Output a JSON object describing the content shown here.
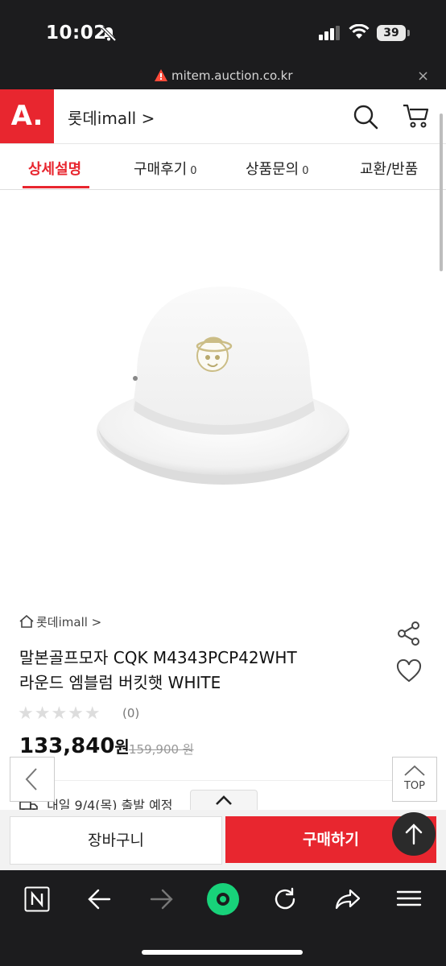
{
  "status": {
    "time": "10:02",
    "battery": "39"
  },
  "browser": {
    "url": "mitem.auction.co.kr",
    "close": "×"
  },
  "header": {
    "logo": "A.",
    "store_link": "롯데imall >"
  },
  "tabs": [
    {
      "label": "상세설명",
      "count": ""
    },
    {
      "label": "구매후기",
      "count": "0"
    },
    {
      "label": "상품문의",
      "count": "0"
    },
    {
      "label": "교환/반품",
      "count": ""
    }
  ],
  "product": {
    "store": "롯데imall >",
    "title_line1": "말본골프모자 CQK M4343PCP42WHT",
    "title_line2": "라운드 엠블럼 버킷햇 WHITE",
    "stars": "★★★★★",
    "rating": 0,
    "review_count": "(0)",
    "price": "133,840",
    "price_unit": "원",
    "original_price": "159,900 원",
    "shipping": "내일 9/4(목) 출발 예정"
  },
  "floating": {
    "top_label": "TOP"
  },
  "bottom": {
    "cart_label": "장바구니",
    "buy_label": "구매하기"
  },
  "colors": {
    "brand": "#e8262f",
    "browser_accent": "#18d27a"
  },
  "icons": [
    "bell-slash-icon",
    "signal-icon",
    "wifi-icon",
    "warning-icon",
    "search-icon",
    "cart-icon",
    "share-icon",
    "heart-icon",
    "truck-icon",
    "chevron-left-icon",
    "chevron-up-icon",
    "arrow-up-icon",
    "naver-icon",
    "back-icon",
    "forward-icon",
    "reload-icon",
    "share-arrow-icon",
    "menu-icon"
  ]
}
